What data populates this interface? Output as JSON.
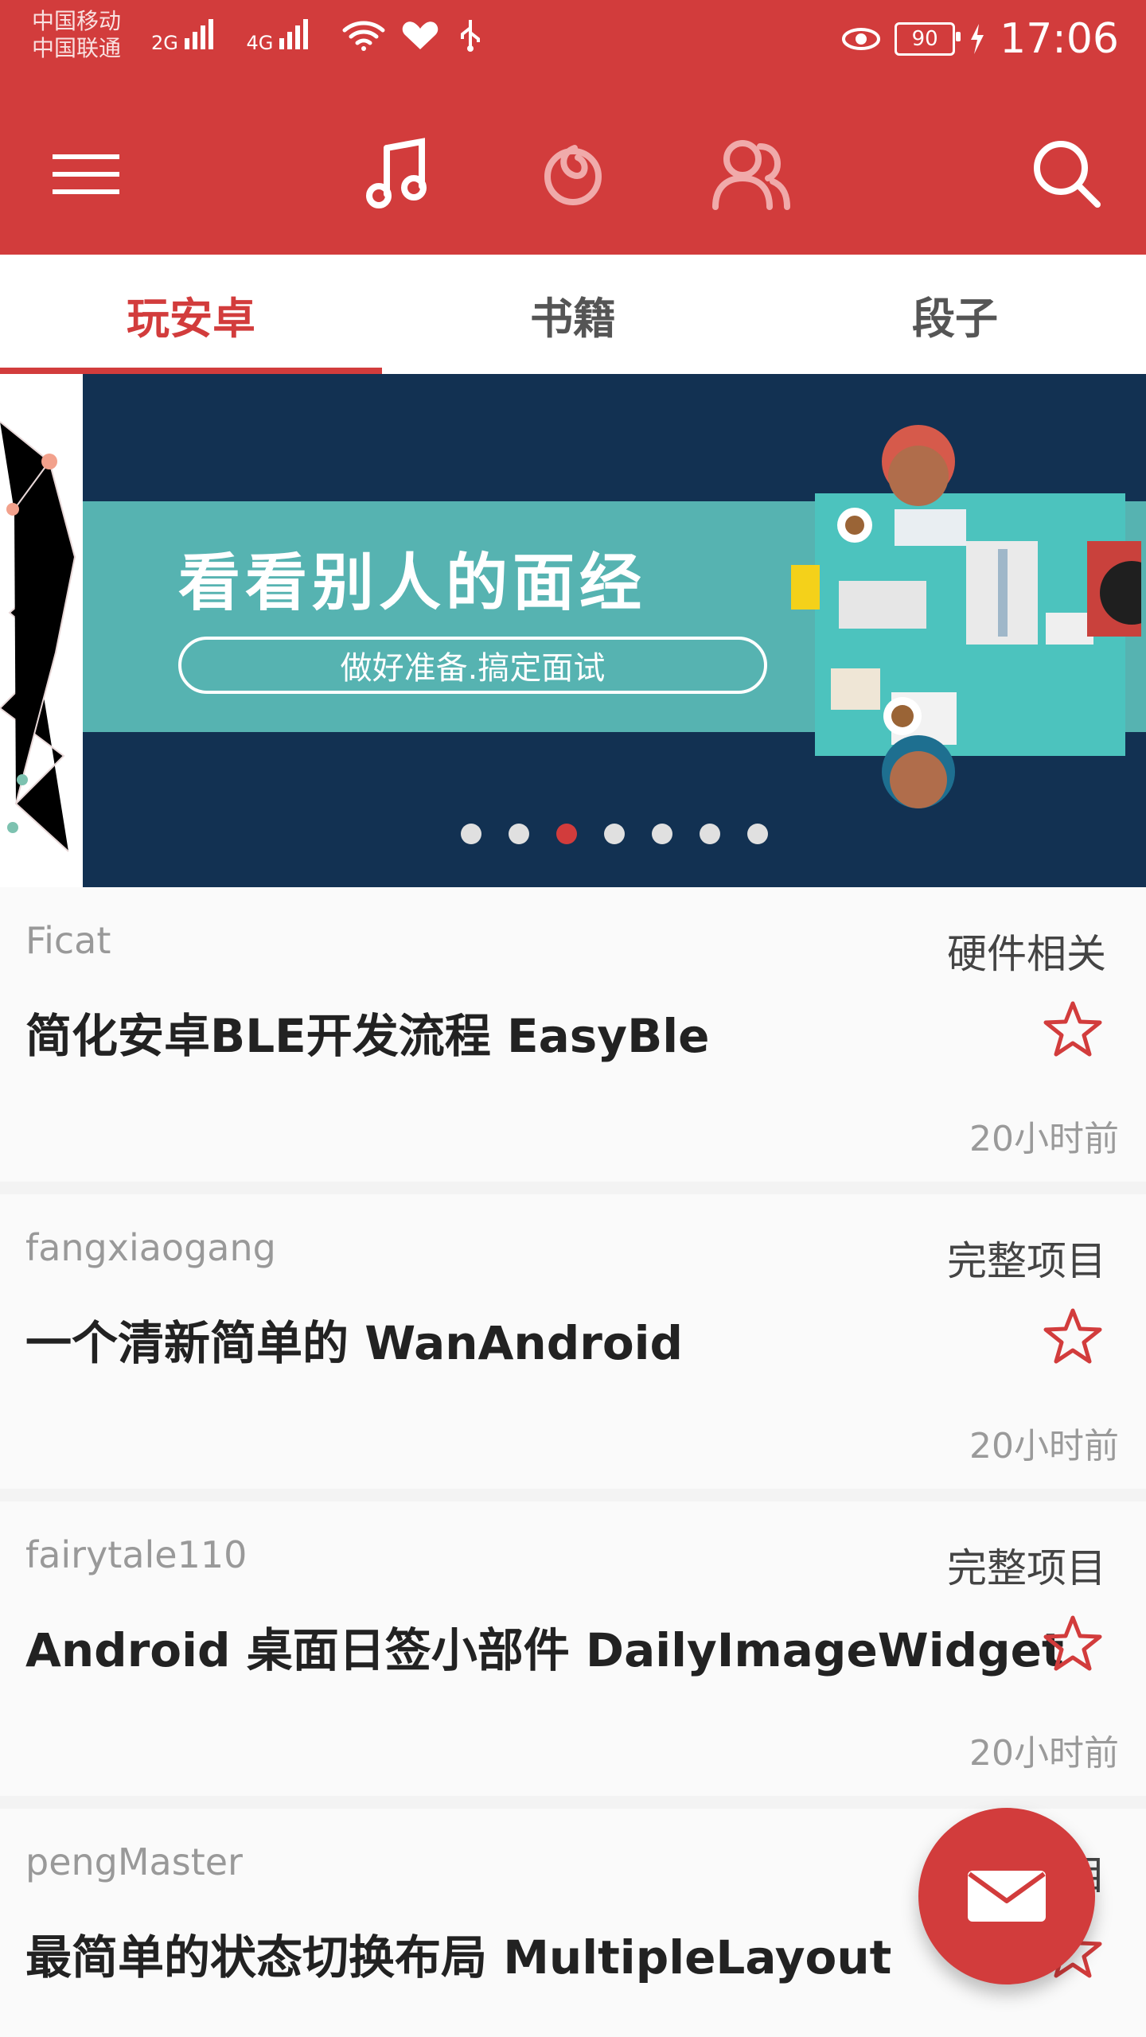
{
  "status_bar": {
    "carrier1": "中国移动",
    "carrier2": "中国联通",
    "net1": "2G",
    "net2": "4G",
    "battery": "90",
    "time": "17:06"
  },
  "toolbar": {
    "icons": [
      "menu-icon",
      "music-icon",
      "netease-icon",
      "friends-icon",
      "search-icon"
    ]
  },
  "tabs": [
    {
      "label": "玩安卓",
      "active": true
    },
    {
      "label": "书籍",
      "active": false
    },
    {
      "label": "段子",
      "active": false
    }
  ],
  "banner": {
    "title": "看看别人的面经",
    "subtitle": "做好准备.搞定面试",
    "active_dot": 3,
    "dot_count": 7
  },
  "articles": [
    {
      "author": "Ficat",
      "category": "硬件相关",
      "title": "简化安卓BLE开发流程 EasyBle",
      "time": "20小时前"
    },
    {
      "author": "fangxiaogang",
      "category": "完整项目",
      "title": "一个清新简单的 WanAndroid",
      "time": "20小时前"
    },
    {
      "author": "fairytale110",
      "category": "完整项目",
      "title": "Android 桌面日签小部件 DailyImageWidget",
      "time": "20小时前"
    },
    {
      "author": "pengMaster",
      "category": "目",
      "title": "最简单的状态切换布局 MultipleLayout",
      "time": ""
    }
  ],
  "colors": {
    "primary": "#d23c3c",
    "banner_dark": "#123152",
    "banner_teal": "#56b3b1"
  },
  "fab": {
    "icon": "mail-icon"
  }
}
